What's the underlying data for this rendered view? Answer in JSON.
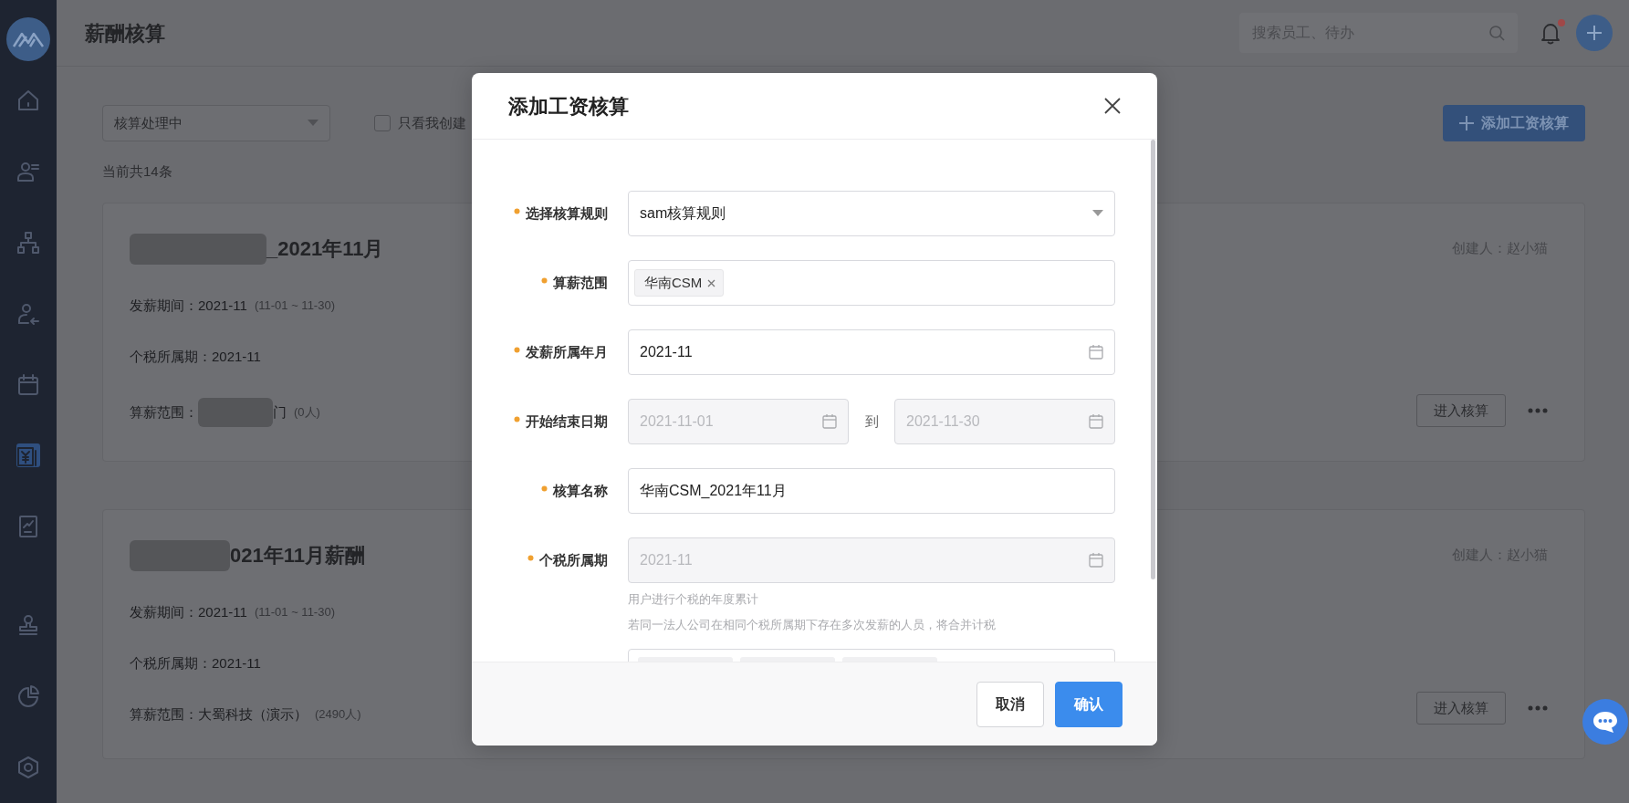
{
  "sidebar": {
    "items": [
      {
        "kind": "home",
        "selected": false
      },
      {
        "kind": "people-list",
        "selected": false
      },
      {
        "kind": "org",
        "selected": false
      },
      {
        "kind": "person-transfer",
        "selected": false
      },
      {
        "kind": "calendar",
        "selected": false
      },
      {
        "kind": "payroll",
        "selected": true
      },
      {
        "kind": "report",
        "selected": false
      }
    ],
    "lower_items": [
      {
        "kind": "stamp",
        "selected": false
      },
      {
        "kind": "pie",
        "selected": false
      },
      {
        "kind": "settings",
        "selected": false
      }
    ]
  },
  "header": {
    "title": "薪酬核算",
    "search": {
      "placeholder": "搜索员工、待办"
    },
    "has_unread": true
  },
  "toolbar": {
    "status_filter": "核算处理中",
    "only_mine": {
      "label": "只看我创建",
      "checked": false
    },
    "add_button": "添加工资核算"
  },
  "count": "当前共14条",
  "cards": [
    {
      "title": "_2021年11月",
      "redacted": true,
      "creator": "创建人：赵小猫",
      "action": "进入核算",
      "rows": [
        {
          "label": "发薪期间：",
          "value": "2021-11",
          "redacted": false,
          "note": "(11-01 ~ 11-30)"
        },
        {
          "label": "个税所属期：",
          "value": "2021-11",
          "redacted": false
        },
        {
          "label": "算薪范围：",
          "value": "门",
          "redacted": true,
          "note": "(0人)"
        }
      ]
    },
    {
      "title": "021年11月薪酬",
      "redacted": true,
      "creator": "创建人：赵小猫",
      "action": "进入核算",
      "rows": [
        {
          "label": "发薪期间：",
          "value": "2021-11",
          "redacted": false,
          "note": "(11-01 ~ 11-30)"
        },
        {
          "label": "个税所属期：",
          "value": "2021-11",
          "redacted": false
        },
        {
          "label": "算薪范围：",
          "value": "大蜀科技（演示）",
          "redacted": false,
          "note": "(2490人)"
        }
      ]
    }
  ],
  "modal": {
    "title": "添加工资核算",
    "fields": [
      {
        "kind": "select",
        "label": "选择核算规则",
        "required": true,
        "value": "sam核算规则"
      },
      {
        "kind": "tags",
        "label": "算薪范围",
        "required": true,
        "tags": [
          "华南CSM"
        ]
      },
      {
        "kind": "date",
        "label": "发薪所属年月",
        "required": true,
        "value": "2021-11",
        "disabled": false
      },
      {
        "kind": "daterange",
        "label": "开始结束日期",
        "required": true,
        "start": "2021-11-01",
        "separator": "到",
        "end": "2021-11-30",
        "disabled": true
      },
      {
        "kind": "text",
        "label": "核算名称",
        "required": true,
        "value": "华南CSM_2021年11月"
      },
      {
        "kind": "date",
        "label": "个税所属期",
        "required": true,
        "value": "2021-11",
        "disabled": true,
        "help": [
          "用户进行个税的年度累计",
          "若同一法人公司在相同个税所属期下存在多次发薪的人员，将合并计税"
        ]
      },
      {
        "kind": "cut"
      }
    ],
    "buttons": [
      {
        "label": "取消",
        "kind": "secondary"
      },
      {
        "label": "确认",
        "kind": "primary"
      }
    ]
  }
}
